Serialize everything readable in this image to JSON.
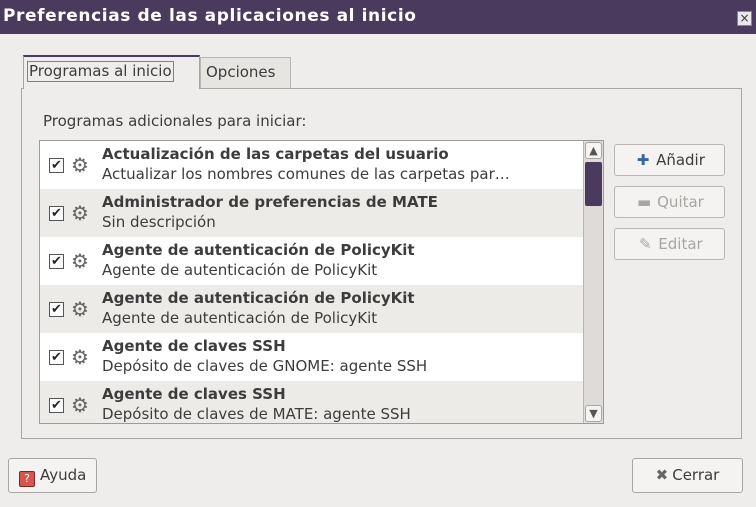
{
  "window": {
    "title": "Preferencias de las aplicaciones al inicio",
    "close_glyph": "×"
  },
  "tabs": [
    {
      "label": "Programas al inicio",
      "active": true
    },
    {
      "label": "Opciones",
      "active": false
    }
  ],
  "section": {
    "label": "Programas adicionales para iniciar:"
  },
  "programs": [
    {
      "name": "Actualización de las carpetas del usuario",
      "description": "Actualizar los nombres comunes de las carpetas par…",
      "checked": true,
      "icon": "gear-cluster-icon"
    },
    {
      "name": "Administrador de preferencias de MATE",
      "description": "Sin descripción",
      "checked": true,
      "icon": "gear-cluster-icon"
    },
    {
      "name": "Agente de autenticación de PolicyKit",
      "description": "Agente de autenticación de PolicyKit",
      "checked": true,
      "icon": "gear-cluster-icon"
    },
    {
      "name": "Agente de autenticación de PolicyKit",
      "description": "Agente de autenticación de PolicyKit",
      "checked": true,
      "icon": "gear-cluster-icon"
    },
    {
      "name": "Agente de claves SSH",
      "description": "Depósito de claves de GNOME: agente SSH",
      "checked": true,
      "icon": "gear-cluster-icon"
    },
    {
      "name": "Agente de claves SSH",
      "description": "Depósito de claves de MATE: agente SSH",
      "checked": true,
      "icon": "gear-cluster-icon"
    }
  ],
  "buttons": {
    "add": "Añadir",
    "remove": "Quitar",
    "edit": "Editar",
    "help": "Ayuda",
    "close": "Cerrar"
  },
  "colors": {
    "accent": "#4a3a5e",
    "add_icon": "#3465a4",
    "help_icon": "#d9534f"
  }
}
